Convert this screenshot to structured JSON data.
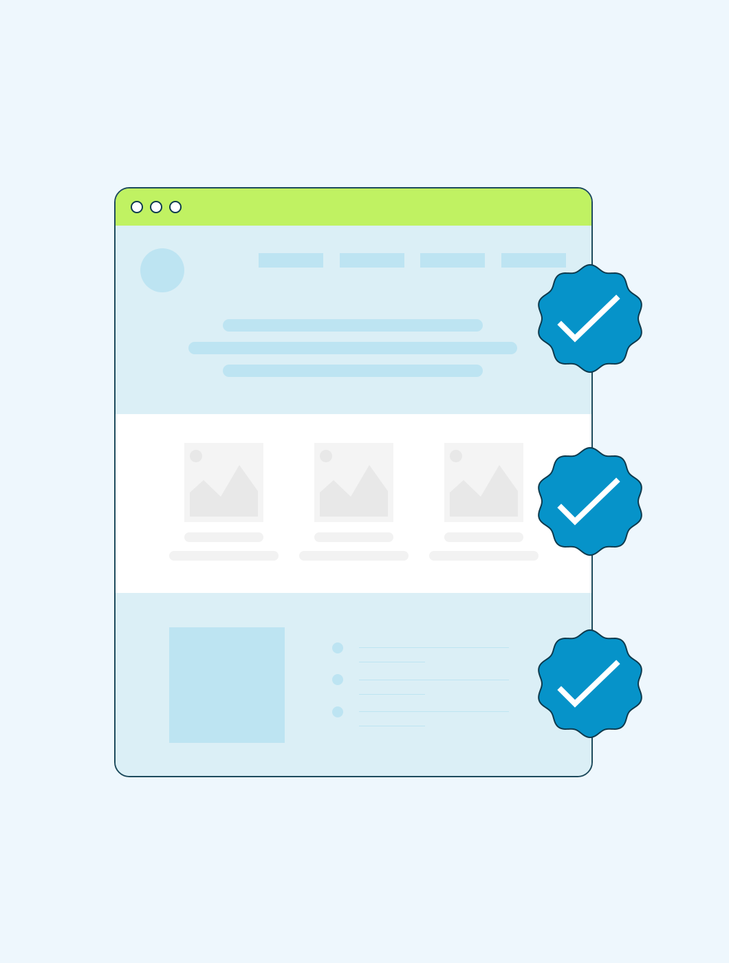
{
  "colors": {
    "page_background": "#eef7fd",
    "window_border": "#1d4a5c",
    "titlebar": "#c0f262",
    "panel_light_blue": "#dbeff6",
    "placeholder_blue": "#bde4f2",
    "card_section": "#ffffff",
    "image_placeholder_bg": "#f4f4f4",
    "image_placeholder_shape": "#e8e8e8",
    "text_placeholder_grey": "#f2f2f2",
    "badge_fill": "#0693c9",
    "badge_outline": "#0e3a4d",
    "checkmark": "#ffffff"
  },
  "window": {
    "controls": [
      "window-dot",
      "window-dot",
      "window-dot"
    ],
    "nav_items": 4,
    "hero_text_lines": 3
  },
  "cards": {
    "count": 3,
    "icon": "image-placeholder-icon"
  },
  "features": {
    "bullet_count": 3
  },
  "badges": {
    "count": 3,
    "icon": "checkmark-icon",
    "shape": "scalloped-seal"
  }
}
